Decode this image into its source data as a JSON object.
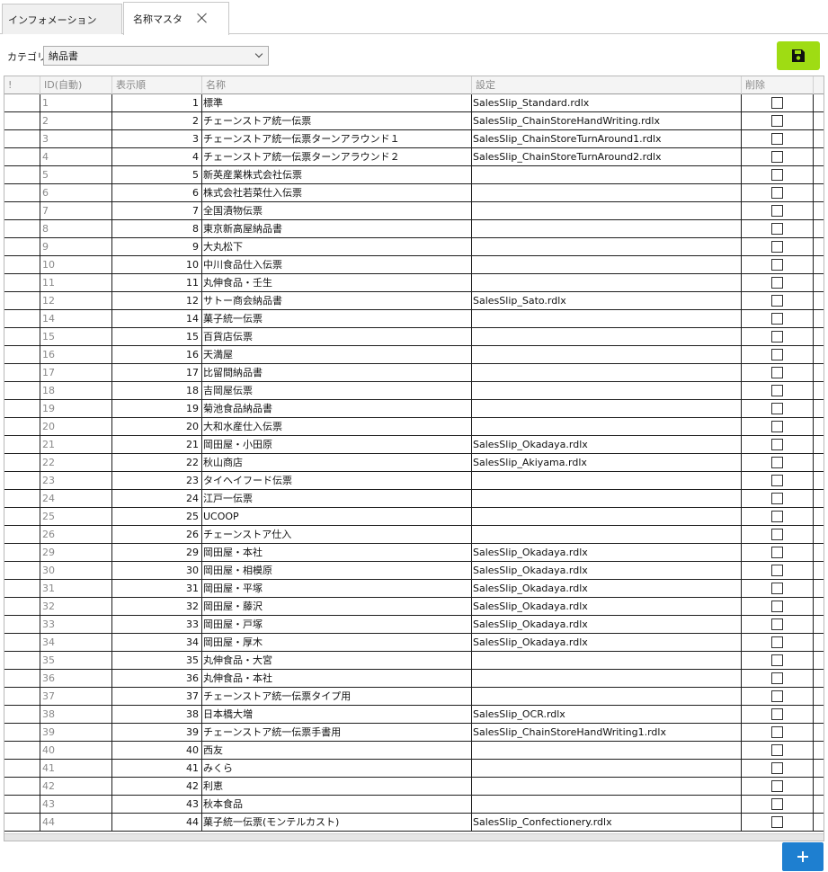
{
  "tabs": [
    {
      "label": "インフォメーション"
    },
    {
      "label": "名称マスタ"
    }
  ],
  "toolbar": {
    "category_label": "カテゴリ",
    "category_value": "納品書"
  },
  "colors": {
    "save_button": "#9fdc13",
    "add_button": "#1e7fd0"
  },
  "icons": {
    "save": "floppy-disk-icon",
    "add": "plus-icon",
    "close_tab": "close-icon"
  },
  "grid": {
    "columns": [
      "!",
      "ID(自動)",
      "表示順",
      "名称",
      "設定",
      "削除"
    ],
    "rows": [
      {
        "id": "1",
        "order": "1",
        "name": "標準",
        "setting": "SalesSlip_Standard.rdlx"
      },
      {
        "id": "2",
        "order": "2",
        "name": "チェーンストア統一伝票",
        "setting": "SalesSlip_ChainStoreHandWriting.rdlx"
      },
      {
        "id": "3",
        "order": "3",
        "name": "チェーンストア統一伝票ターンアラウンド１",
        "setting": "SalesSlip_ChainStoreTurnAround1.rdlx"
      },
      {
        "id": "4",
        "order": "4",
        "name": "チェーンストア統一伝票ターンアラウンド２",
        "setting": "SalesSlip_ChainStoreTurnAround2.rdlx"
      },
      {
        "id": "5",
        "order": "5",
        "name": "新英産業株式会社伝票",
        "setting": ""
      },
      {
        "id": "6",
        "order": "6",
        "name": "株式会社若菜仕入伝票",
        "setting": ""
      },
      {
        "id": "7",
        "order": "7",
        "name": "全国漬物伝票",
        "setting": ""
      },
      {
        "id": "8",
        "order": "8",
        "name": "東京新高屋納品書",
        "setting": ""
      },
      {
        "id": "9",
        "order": "9",
        "name": "大丸松下",
        "setting": ""
      },
      {
        "id": "10",
        "order": "10",
        "name": "中川食品仕入伝票",
        "setting": ""
      },
      {
        "id": "11",
        "order": "11",
        "name": "丸伸食品・壬生",
        "setting": ""
      },
      {
        "id": "12",
        "order": "12",
        "name": "サトー商会納品書",
        "setting": "SalesSlip_Sato.rdlx"
      },
      {
        "id": "14",
        "order": "14",
        "name": "菓子統一伝票",
        "setting": ""
      },
      {
        "id": "15",
        "order": "15",
        "name": "百貨店伝票",
        "setting": ""
      },
      {
        "id": "16",
        "order": "16",
        "name": "天満屋",
        "setting": ""
      },
      {
        "id": "17",
        "order": "17",
        "name": "比留間納品書",
        "setting": ""
      },
      {
        "id": "18",
        "order": "18",
        "name": "吉岡屋伝票",
        "setting": ""
      },
      {
        "id": "19",
        "order": "19",
        "name": "菊池食品納品書",
        "setting": ""
      },
      {
        "id": "20",
        "order": "20",
        "name": "大和水産仕入伝票",
        "setting": ""
      },
      {
        "id": "21",
        "order": "21",
        "name": "岡田屋・小田原",
        "setting": "SalesSlip_Okadaya.rdlx"
      },
      {
        "id": "22",
        "order": "22",
        "name": "秋山商店",
        "setting": "SalesSlip_Akiyama.rdlx"
      },
      {
        "id": "23",
        "order": "23",
        "name": "タイヘイフード伝票",
        "setting": ""
      },
      {
        "id": "24",
        "order": "24",
        "name": "江戸一伝票",
        "setting": ""
      },
      {
        "id": "25",
        "order": "25",
        "name": "UCOOP",
        "setting": ""
      },
      {
        "id": "26",
        "order": "26",
        "name": "チェーンストア仕入",
        "setting": ""
      },
      {
        "id": "29",
        "order": "29",
        "name": "岡田屋・本社",
        "setting": "SalesSlip_Okadaya.rdlx"
      },
      {
        "id": "30",
        "order": "30",
        "name": "岡田屋・相模原",
        "setting": "SalesSlip_Okadaya.rdlx"
      },
      {
        "id": "31",
        "order": "31",
        "name": "岡田屋・平塚",
        "setting": "SalesSlip_Okadaya.rdlx"
      },
      {
        "id": "32",
        "order": "32",
        "name": "岡田屋・藤沢",
        "setting": "SalesSlip_Okadaya.rdlx"
      },
      {
        "id": "33",
        "order": "33",
        "name": "岡田屋・戸塚",
        "setting": "SalesSlip_Okadaya.rdlx"
      },
      {
        "id": "34",
        "order": "34",
        "name": "岡田屋・厚木",
        "setting": "SalesSlip_Okadaya.rdlx"
      },
      {
        "id": "35",
        "order": "35",
        "name": "丸伸食品・大宮",
        "setting": ""
      },
      {
        "id": "36",
        "order": "36",
        "name": "丸伸食品・本社",
        "setting": ""
      },
      {
        "id": "37",
        "order": "37",
        "name": "チェーンストア統一伝票タイプ用",
        "setting": ""
      },
      {
        "id": "38",
        "order": "38",
        "name": "日本橋大増",
        "setting": "SalesSlip_OCR.rdlx"
      },
      {
        "id": "39",
        "order": "39",
        "name": "チェーンストア統一伝票手書用",
        "setting": "SalesSlip_ChainStoreHandWriting1.rdlx"
      },
      {
        "id": "40",
        "order": "40",
        "name": "西友",
        "setting": ""
      },
      {
        "id": "41",
        "order": "41",
        "name": "みくら",
        "setting": ""
      },
      {
        "id": "42",
        "order": "42",
        "name": "利恵",
        "setting": ""
      },
      {
        "id": "43",
        "order": "43",
        "name": "秋本食品",
        "setting": ""
      },
      {
        "id": "44",
        "order": "44",
        "name": "菓子統一伝票(モンテルカスト)",
        "setting": "SalesSlip_Confectionery.rdlx"
      }
    ]
  }
}
